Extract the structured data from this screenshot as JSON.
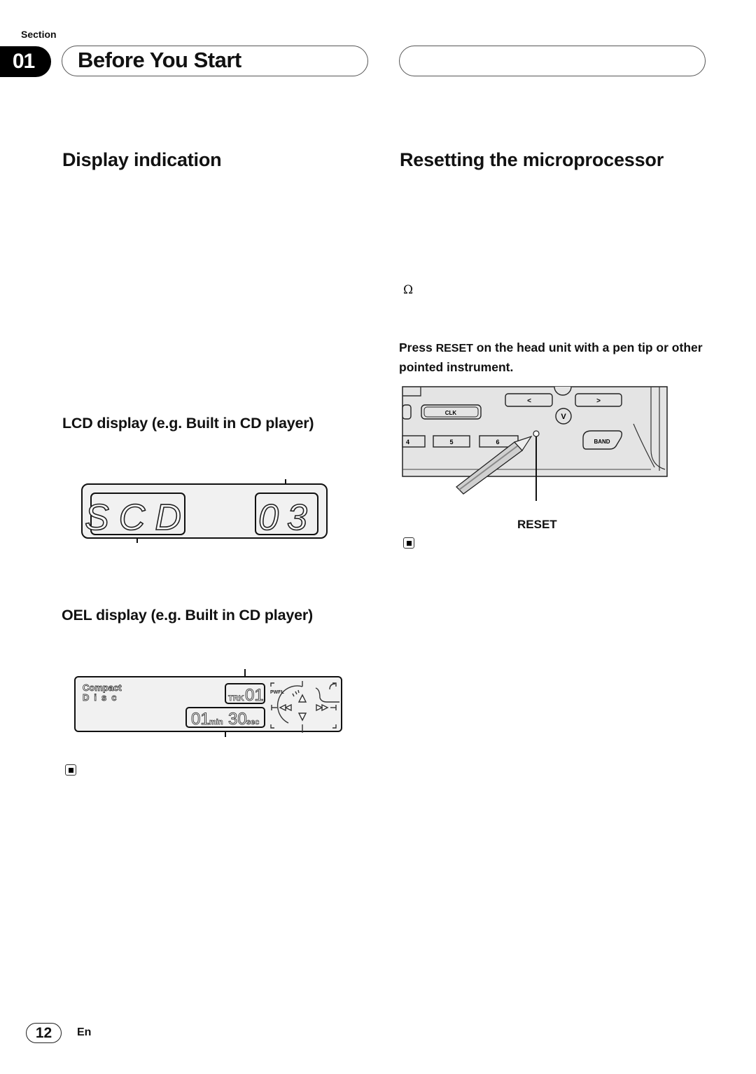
{
  "header": {
    "section_label": "Section",
    "section_number": "01",
    "title": "Before You Start"
  },
  "left_column": {
    "heading": "Display indication",
    "lcd": {
      "caption": "LCD display (e.g. Built in CD player)",
      "source_text": "SCD",
      "track_text": "03"
    },
    "oel": {
      "caption": "OEL display (e.g. Built in CD player)",
      "source_line1": "Compact",
      "source_line2": "Disc",
      "track_prefix": "TRK",
      "track_number": "01",
      "minutes": "01",
      "min_label": "min",
      "seconds": "30",
      "sec_label": "sec",
      "indicator": "PWFL"
    },
    "end_icon": "end-of-section-icon"
  },
  "right_column": {
    "heading": "Resetting the microprocessor",
    "omega_symbol": "Ω",
    "instruction_prefix": "Press",
    "instruction_key": "RESET",
    "instruction_rest": "on the head unit with a pen tip or other pointed instrument.",
    "illustration": {
      "buttons": {
        "clk": "CLK",
        "preset_4": "4",
        "preset_5": "5",
        "preset_6": "6",
        "band": "BAND",
        "left": "<",
        "right": ">",
        "down": "V"
      },
      "reset_label": "RESET"
    },
    "end_icon": "end-of-section-icon"
  },
  "footer": {
    "page_number": "12",
    "language": "En"
  }
}
